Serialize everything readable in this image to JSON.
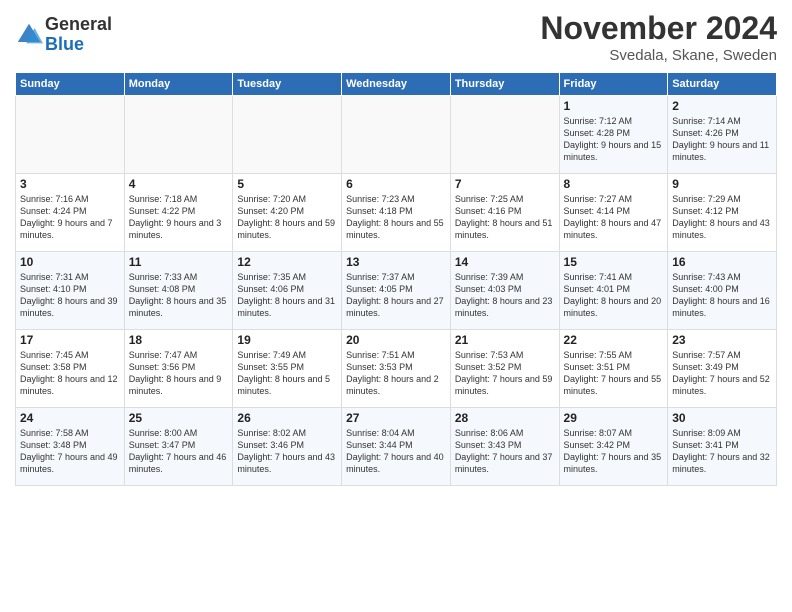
{
  "header": {
    "logo_general": "General",
    "logo_blue": "Blue",
    "month_title": "November 2024",
    "location": "Svedala, Skane, Sweden"
  },
  "weekdays": [
    "Sunday",
    "Monday",
    "Tuesday",
    "Wednesday",
    "Thursday",
    "Friday",
    "Saturday"
  ],
  "weeks": [
    [
      {
        "day": "",
        "info": ""
      },
      {
        "day": "",
        "info": ""
      },
      {
        "day": "",
        "info": ""
      },
      {
        "day": "",
        "info": ""
      },
      {
        "day": "",
        "info": ""
      },
      {
        "day": "1",
        "info": "Sunrise: 7:12 AM\nSunset: 4:28 PM\nDaylight: 9 hours and 15 minutes."
      },
      {
        "day": "2",
        "info": "Sunrise: 7:14 AM\nSunset: 4:26 PM\nDaylight: 9 hours and 11 minutes."
      }
    ],
    [
      {
        "day": "3",
        "info": "Sunrise: 7:16 AM\nSunset: 4:24 PM\nDaylight: 9 hours and 7 minutes."
      },
      {
        "day": "4",
        "info": "Sunrise: 7:18 AM\nSunset: 4:22 PM\nDaylight: 9 hours and 3 minutes."
      },
      {
        "day": "5",
        "info": "Sunrise: 7:20 AM\nSunset: 4:20 PM\nDaylight: 8 hours and 59 minutes."
      },
      {
        "day": "6",
        "info": "Sunrise: 7:23 AM\nSunset: 4:18 PM\nDaylight: 8 hours and 55 minutes."
      },
      {
        "day": "7",
        "info": "Sunrise: 7:25 AM\nSunset: 4:16 PM\nDaylight: 8 hours and 51 minutes."
      },
      {
        "day": "8",
        "info": "Sunrise: 7:27 AM\nSunset: 4:14 PM\nDaylight: 8 hours and 47 minutes."
      },
      {
        "day": "9",
        "info": "Sunrise: 7:29 AM\nSunset: 4:12 PM\nDaylight: 8 hours and 43 minutes."
      }
    ],
    [
      {
        "day": "10",
        "info": "Sunrise: 7:31 AM\nSunset: 4:10 PM\nDaylight: 8 hours and 39 minutes."
      },
      {
        "day": "11",
        "info": "Sunrise: 7:33 AM\nSunset: 4:08 PM\nDaylight: 8 hours and 35 minutes."
      },
      {
        "day": "12",
        "info": "Sunrise: 7:35 AM\nSunset: 4:06 PM\nDaylight: 8 hours and 31 minutes."
      },
      {
        "day": "13",
        "info": "Sunrise: 7:37 AM\nSunset: 4:05 PM\nDaylight: 8 hours and 27 minutes."
      },
      {
        "day": "14",
        "info": "Sunrise: 7:39 AM\nSunset: 4:03 PM\nDaylight: 8 hours and 23 minutes."
      },
      {
        "day": "15",
        "info": "Sunrise: 7:41 AM\nSunset: 4:01 PM\nDaylight: 8 hours and 20 minutes."
      },
      {
        "day": "16",
        "info": "Sunrise: 7:43 AM\nSunset: 4:00 PM\nDaylight: 8 hours and 16 minutes."
      }
    ],
    [
      {
        "day": "17",
        "info": "Sunrise: 7:45 AM\nSunset: 3:58 PM\nDaylight: 8 hours and 12 minutes."
      },
      {
        "day": "18",
        "info": "Sunrise: 7:47 AM\nSunset: 3:56 PM\nDaylight: 8 hours and 9 minutes."
      },
      {
        "day": "19",
        "info": "Sunrise: 7:49 AM\nSunset: 3:55 PM\nDaylight: 8 hours and 5 minutes."
      },
      {
        "day": "20",
        "info": "Sunrise: 7:51 AM\nSunset: 3:53 PM\nDaylight: 8 hours and 2 minutes."
      },
      {
        "day": "21",
        "info": "Sunrise: 7:53 AM\nSunset: 3:52 PM\nDaylight: 7 hours and 59 minutes."
      },
      {
        "day": "22",
        "info": "Sunrise: 7:55 AM\nSunset: 3:51 PM\nDaylight: 7 hours and 55 minutes."
      },
      {
        "day": "23",
        "info": "Sunrise: 7:57 AM\nSunset: 3:49 PM\nDaylight: 7 hours and 52 minutes."
      }
    ],
    [
      {
        "day": "24",
        "info": "Sunrise: 7:58 AM\nSunset: 3:48 PM\nDaylight: 7 hours and 49 minutes."
      },
      {
        "day": "25",
        "info": "Sunrise: 8:00 AM\nSunset: 3:47 PM\nDaylight: 7 hours and 46 minutes."
      },
      {
        "day": "26",
        "info": "Sunrise: 8:02 AM\nSunset: 3:46 PM\nDaylight: 7 hours and 43 minutes."
      },
      {
        "day": "27",
        "info": "Sunrise: 8:04 AM\nSunset: 3:44 PM\nDaylight: 7 hours and 40 minutes."
      },
      {
        "day": "28",
        "info": "Sunrise: 8:06 AM\nSunset: 3:43 PM\nDaylight: 7 hours and 37 minutes."
      },
      {
        "day": "29",
        "info": "Sunrise: 8:07 AM\nSunset: 3:42 PM\nDaylight: 7 hours and 35 minutes."
      },
      {
        "day": "30",
        "info": "Sunrise: 8:09 AM\nSunset: 3:41 PM\nDaylight: 7 hours and 32 minutes."
      }
    ]
  ]
}
